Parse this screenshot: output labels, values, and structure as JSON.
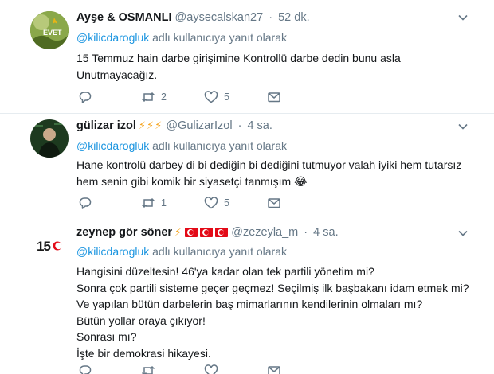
{
  "tweets": [
    {
      "name": "Ayşe & OSMANLI",
      "handle": "@aysecalskan27",
      "time": "52 dk.",
      "replying_prefix": "@kilicdarogluk",
      "replying_suffix": " adlı kullanıcıya yanıt olarak",
      "lines": [
        "15 Temmuz hain darbe girişimine Kontrollü darbe dedin bunu asla",
        "Unutmayacağız."
      ],
      "retweets": "2",
      "likes": "5",
      "avatar_label": "EVET"
    },
    {
      "name": "gülizar izol",
      "name_emoji": "⚡⚡⚡",
      "handle": "@GulizarIzol",
      "time": "4 sa.",
      "replying_prefix": "@kilicdarogluk",
      "replying_suffix": " adlı kullanıcıya yanıt olarak",
      "lines": [
        "Hane kontrolü darbey di bi dediğin bi dediğini tutmuyor valah iyiki hem tutarsız",
        "hem  senin gibi komik bir siyasetçi tanmışım 😂"
      ],
      "retweets": "1",
      "likes": "5"
    },
    {
      "name": "zeynep gör söner",
      "name_emoji": "⚡",
      "handle": "@zezeyla_m",
      "time": "4 sa.",
      "replying_prefix": "@kilicdarogluk",
      "replying_suffix": " adlı kullanıcıya yanıt olarak",
      "lines": [
        "Hangisini düzeltesin! 46'ya kadar olan tek partili yönetim mi?",
        "Sonra çok partili sisteme geçer geçmez! Seçilmiş ilk başbakanı idam etmek mi?",
        "Ve yapılan bütün darbelerin baş mimarlarının kendilerinin olmaları mı?",
        "Bütün yollar oraya çıkıyor!",
        "Sonrası mı?",
        "İşte bir demokrasi hikayesi."
      ],
      "avatar_label": "15"
    }
  ],
  "colors": {
    "accent": "#1b95e0",
    "muted": "#657786",
    "divider": "#e6ecf0"
  },
  "icons": [
    "reply-icon",
    "retweet-icon",
    "like-icon",
    "message-icon",
    "chevron-down-icon"
  ]
}
